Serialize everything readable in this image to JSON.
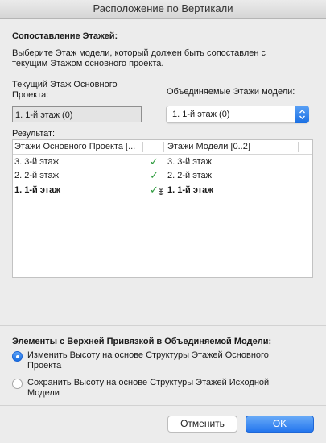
{
  "window": {
    "title": "Расположение по Вертикали"
  },
  "mapping": {
    "heading": "Сопоставление Этажей:",
    "description_line1": "Выберите Этаж модели, который должен быть сопоставлен с",
    "description_line2": "текущим Этажом основного проекта.",
    "current_label_line1": "Текущий Этаж Основного",
    "current_label_line2": "Проекта:",
    "current_value": "1. 1-й этаж (0)",
    "merged_label": "Объединяемые Этажи модели:",
    "merged_value": "1. 1-й этаж (0)"
  },
  "result": {
    "label": "Результат:",
    "columns": [
      "Этажи Основного Проекта [...",
      "Этажи Модели [0..2]"
    ],
    "rows": [
      {
        "main": "3. 3-й этаж",
        "model": "3. 3-й этаж",
        "bold": false,
        "check": "✓"
      },
      {
        "main": "2. 2-й этаж",
        "model": "2. 2-й этаж",
        "bold": false,
        "check": "✓"
      },
      {
        "main": "1. 1-й этаж",
        "model": "1. 1-й этаж",
        "bold": true,
        "check": "✓"
      }
    ]
  },
  "anchor": {
    "heading": "Элементы с Верхней Привязкой в Объединяемой Модели:",
    "option1_line1": "Изменить Высоту на основе Структуры Этажей Основного",
    "option1_line2": "Проекта",
    "option1_selected": true,
    "option2_line1": "Сохранить Высоту на основе Структуры Этажей Исходной",
    "option2_line2": "Модели",
    "option2_selected": false
  },
  "buttons": {
    "cancel": "Отменить",
    "ok": "OK"
  },
  "colors": {
    "accent": "#1a6fe3",
    "check": "#2e9b3e"
  }
}
